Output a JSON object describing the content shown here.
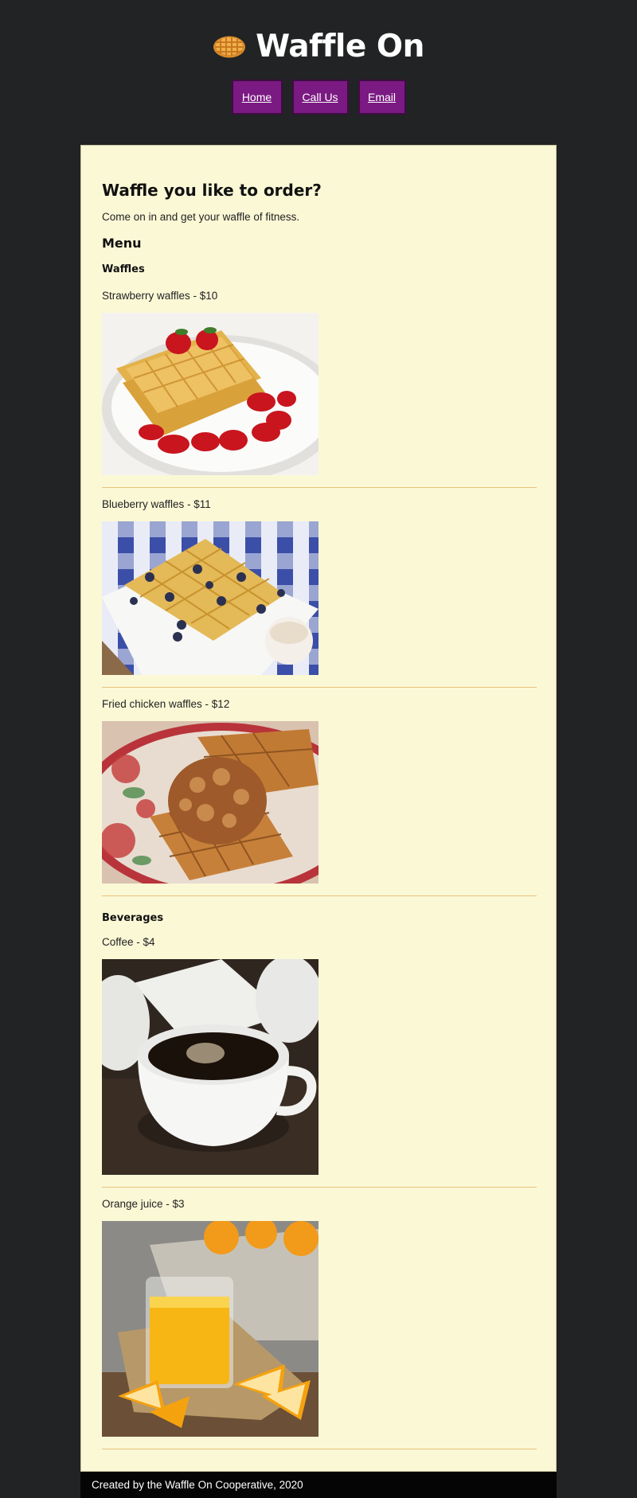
{
  "header": {
    "logo_icon": "waffle-icon",
    "title": "Waffle On",
    "nav": [
      {
        "label": "Home"
      },
      {
        "label": "Call Us"
      },
      {
        "label": "Email"
      }
    ],
    "nav_color": "#7a1a82"
  },
  "main": {
    "title": "Waffle you like to order?",
    "intro": "Come on in and get your waffle of fitness.",
    "menu_heading": "Menu",
    "sections": [
      {
        "heading": "Waffles",
        "items": [
          {
            "name": "Strawberry waffles - $10",
            "photo": "strawberry-waffles-photo"
          },
          {
            "name": "Blueberry waffles - $11",
            "photo": "blueberry-waffles-photo"
          },
          {
            "name": "Fried chicken waffles - $12",
            "photo": "fried-chicken-waffles-photo"
          }
        ]
      },
      {
        "heading": "Beverages",
        "items": [
          {
            "name": "Coffee - $4",
            "photo": "coffee-photo"
          },
          {
            "name": "Orange juice - $3",
            "photo": "orange-juice-photo"
          }
        ]
      }
    ],
    "background": "#fbf8d6",
    "rule_color": "#e8c27a"
  },
  "footer": {
    "text": "Created by the Waffle On Cooperative, 2020"
  }
}
